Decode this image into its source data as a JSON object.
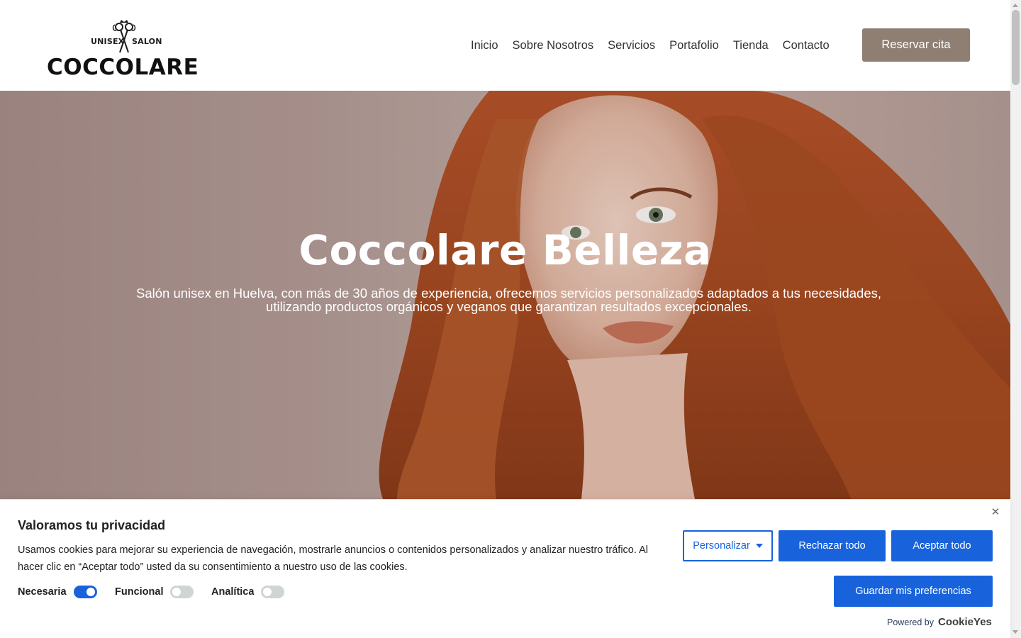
{
  "header": {
    "logo": {
      "top_left": "UNISEX",
      "top_right": "SALON",
      "name": "COCCOLARE"
    },
    "nav": [
      "Inicio",
      "Sobre Nosotros",
      "Servicios",
      "Portafolio",
      "Tienda",
      "Contacto"
    ],
    "cta_label": "Reservar cita",
    "cta_color": "#8f7f72"
  },
  "hero": {
    "title": "Coccolare Belleza",
    "subtitle_line1": "Salón unisex en Huelva, con más de 30 años de experiencia, ofrecemos servicios personalizados adaptados a tus necesidades,",
    "subtitle_line2": "utilizando productos orgánicos y veganos que garantizan resultados excepcionales."
  },
  "cookie_banner": {
    "title": "Valoramos tu privacidad",
    "text": "Usamos cookies para mejorar su experiencia de navegación, mostrarle anuncios o contenidos personalizados y analizar nuestro tráfico. Al hacer clic en “Aceptar todo” usted da su consentimiento a nuestro uso de las cookies.",
    "toggles": [
      {
        "label": "Necesaria",
        "on": true
      },
      {
        "label": "Funcional",
        "on": false
      },
      {
        "label": "Analítica",
        "on": false
      }
    ],
    "customize_label": "Personalizar",
    "reject_label": "Rechazar todo",
    "accept_label": "Aceptar todo",
    "save_label": "Guardar mis preferencias",
    "powered_text": "Powered by",
    "powered_brand": "CookieYes",
    "accent_color": "#1863dc"
  }
}
